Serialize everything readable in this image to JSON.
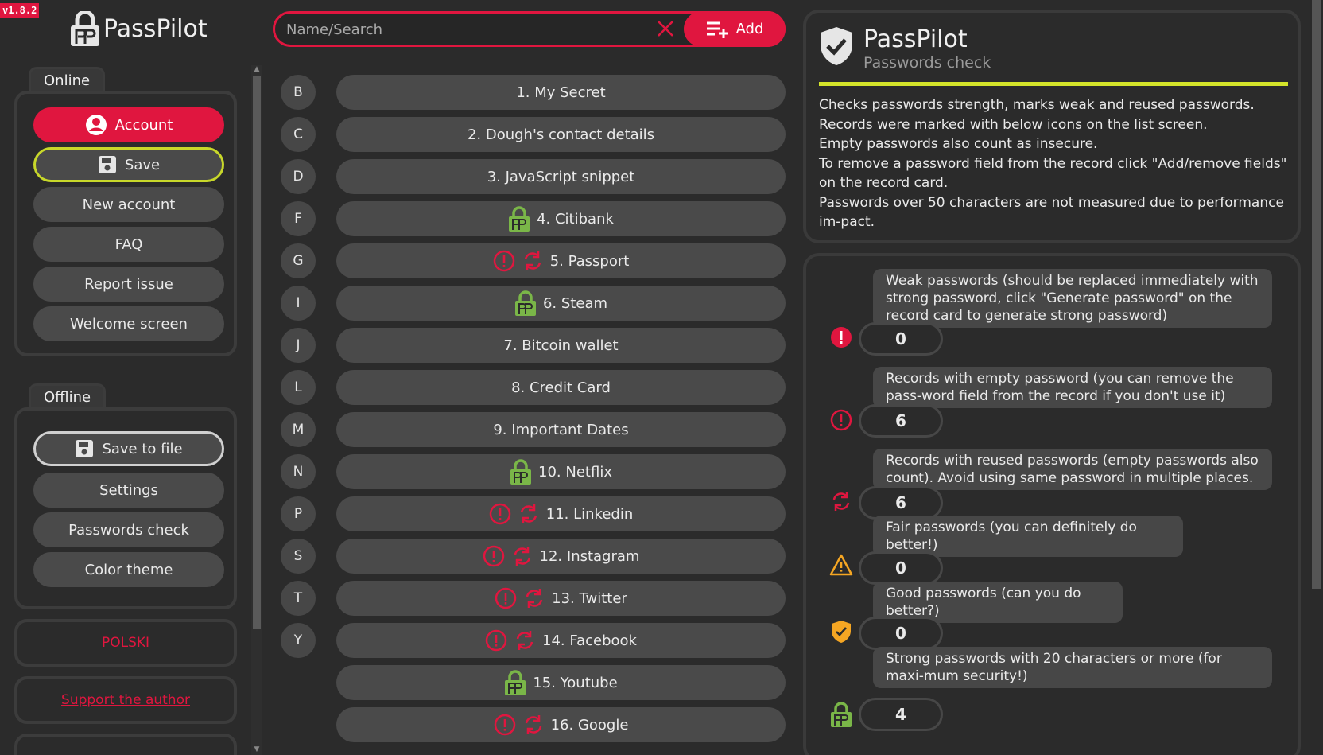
{
  "version": "v1.8.2",
  "app_name": "PassPilot",
  "colors": {
    "accent": "#e0163f",
    "highlight": "#d4e42a",
    "lock_green": "#7ab648",
    "warning": "#f5a623"
  },
  "sidebar": {
    "online_label": "Online",
    "online_items": [
      {
        "label": "Account",
        "icon": "user-circle-icon"
      },
      {
        "label": "Save",
        "icon": "floppy-icon"
      },
      {
        "label": "New account"
      },
      {
        "label": "FAQ"
      },
      {
        "label": "Report issue"
      },
      {
        "label": "Welcome screen"
      }
    ],
    "offline_label": "Offline",
    "offline_items": [
      {
        "label": "Save to file",
        "icon": "floppy-icon"
      },
      {
        "label": "Settings"
      },
      {
        "label": "Passwords check"
      },
      {
        "label": "Color theme"
      }
    ],
    "language_link": "POLSKI",
    "support_link": "Support the author"
  },
  "search": {
    "placeholder": "Name/Search",
    "value": "",
    "add_label": "Add"
  },
  "records": [
    {
      "letter": "B",
      "label": "1. My Secret",
      "icons": []
    },
    {
      "letter": "C",
      "label": "2. Dough's contact details",
      "icons": []
    },
    {
      "letter": "D",
      "label": "3. JavaScript snippet",
      "icons": []
    },
    {
      "letter": "F",
      "label": "4. Citibank",
      "icons": [
        "strong-lock-icon"
      ]
    },
    {
      "letter": "G",
      "label": "5. Passport",
      "icons": [
        "empty-password-icon",
        "reused-icon"
      ]
    },
    {
      "letter": "I",
      "label": "6. Steam",
      "icons": [
        "strong-lock-icon"
      ]
    },
    {
      "letter": "J",
      "label": "7. Bitcoin wallet",
      "icons": []
    },
    {
      "letter": "L",
      "label": "8. Credit Card",
      "icons": []
    },
    {
      "letter": "M",
      "label": "9. Important Dates",
      "icons": []
    },
    {
      "letter": "N",
      "label": "10. Netflix",
      "icons": [
        "strong-lock-icon"
      ]
    },
    {
      "letter": "P",
      "label": "11. Linkedin",
      "icons": [
        "empty-password-icon",
        "reused-icon"
      ]
    },
    {
      "letter": "S",
      "label": "12. Instagram",
      "icons": [
        "empty-password-icon",
        "reused-icon"
      ]
    },
    {
      "letter": "T",
      "label": "13. Twitter",
      "icons": [
        "empty-password-icon",
        "reused-icon"
      ]
    },
    {
      "letter": "Y",
      "label": "14. Facebook",
      "icons": [
        "empty-password-icon",
        "reused-icon"
      ]
    },
    {
      "letter": "",
      "label": "15. Youtube",
      "icons": [
        "strong-lock-icon"
      ]
    },
    {
      "letter": "",
      "label": "16. Google",
      "icons": [
        "empty-password-icon",
        "reused-icon"
      ]
    }
  ],
  "check_panel": {
    "title": "PassPilot",
    "subtitle": "Passwords check",
    "description": [
      "Checks passwords strength, marks weak and reused passwords.",
      "Records were marked with below icons on the list screen.",
      "Empty passwords also count as insecure.",
      "To remove a password field from the record click \"Add/remove fields\" on the record card.",
      "Passwords over 50 characters are not measured due to performance im-pact."
    ]
  },
  "stats": [
    {
      "icon": "weak-password-icon",
      "text": "Weak passwords (should be replaced immediately with strong password, click \"Generate password\" on the record card to generate strong password)",
      "count": "0"
    },
    {
      "icon": "empty-password-icon",
      "text": "Records with empty password (you can remove the pass-word field from the record if you don't use it)",
      "count": "6"
    },
    {
      "icon": "reused-icon",
      "text": "Records with reused passwords (empty passwords also count). Avoid using same password in multiple places.",
      "count": "6"
    },
    {
      "icon": "warning-triangle-icon",
      "text": "Fair passwords (you can definitely do better!)",
      "count": "0"
    },
    {
      "icon": "shield-check-icon",
      "text": "Good passwords (can you do better?)",
      "count": "0"
    },
    {
      "icon": "strong-lock-icon",
      "text": "Strong passwords with 20 characters or more (for maxi-mum security!)",
      "count": "4"
    }
  ]
}
